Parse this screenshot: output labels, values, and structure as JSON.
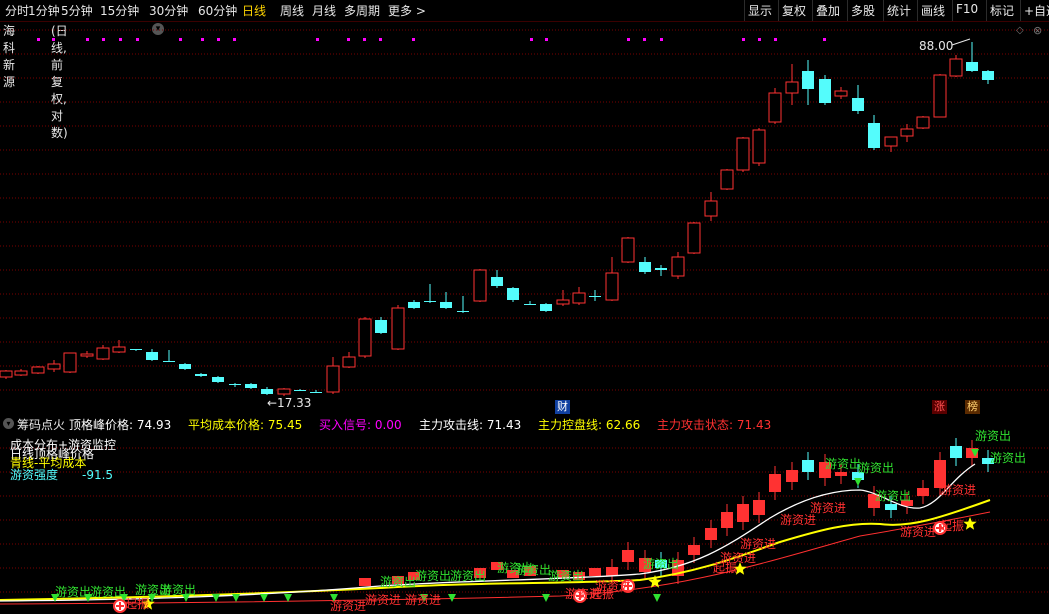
{
  "toolbar": {
    "periods": [
      "分时",
      "1分钟",
      "5分钟",
      "15分钟",
      "30分钟",
      "60分钟",
      "日线",
      "周线",
      "月线",
      "多周期",
      "更多 >"
    ],
    "active_period": "日线",
    "right": [
      "显示",
      "复权",
      "叠加",
      "多股",
      "统计",
      "画线",
      "F10",
      "标记",
      "+自选"
    ]
  },
  "stock": {
    "name": "海科新源",
    "mode": "(日线,前复权,对数)"
  },
  "main_chart": {
    "high_label": "88.00",
    "low_label": "17.33",
    "marker_cai": "财",
    "marker_zhang": "涨",
    "marker_bang": "榜"
  },
  "indicator": {
    "name": "筹码点火",
    "items": [
      {
        "label": "顶格峰价格:",
        "value": "74.93",
        "color": "#ffffff"
      },
      {
        "label": "平均成本价格:",
        "value": "75.45",
        "color": "#ffff00"
      },
      {
        "label": "买入信号:",
        "value": "0.00",
        "color": "#ff00ff"
      },
      {
        "label": "主力攻击线:",
        "value": "71.43",
        "color": "#ffffff"
      },
      {
        "label": "主力控盘线:",
        "value": "62.66",
        "color": "#ffff00"
      },
      {
        "label": "主力攻击状态:",
        "value": "71.43",
        "color": "#ff3030"
      }
    ],
    "legend_lines": [
      "成本分布+游资监控",
      "日线顶格峰价格",
      "青线-平均成本",
      "游资强度"
    ],
    "strength_value": "-91.5",
    "tag_out": "游资出",
    "tag_in": "游资进",
    "tag_start": "起振"
  },
  "chart_data": {
    "type": "candlestick",
    "price_high": 88.0,
    "price_low": 17.33,
    "indicator_values": {
      "top_peak_price": 74.93,
      "avg_cost": 75.45,
      "buy_signal": 0.0,
      "attack_line": 71.43,
      "control_line": 62.66,
      "attack_state": 71.43
    }
  },
  "colors": {
    "up": "#ff3232",
    "down": "#54fcfc",
    "grid": "#7a0000",
    "yellow": "#ffff00",
    "magenta": "#ff00ff"
  }
}
